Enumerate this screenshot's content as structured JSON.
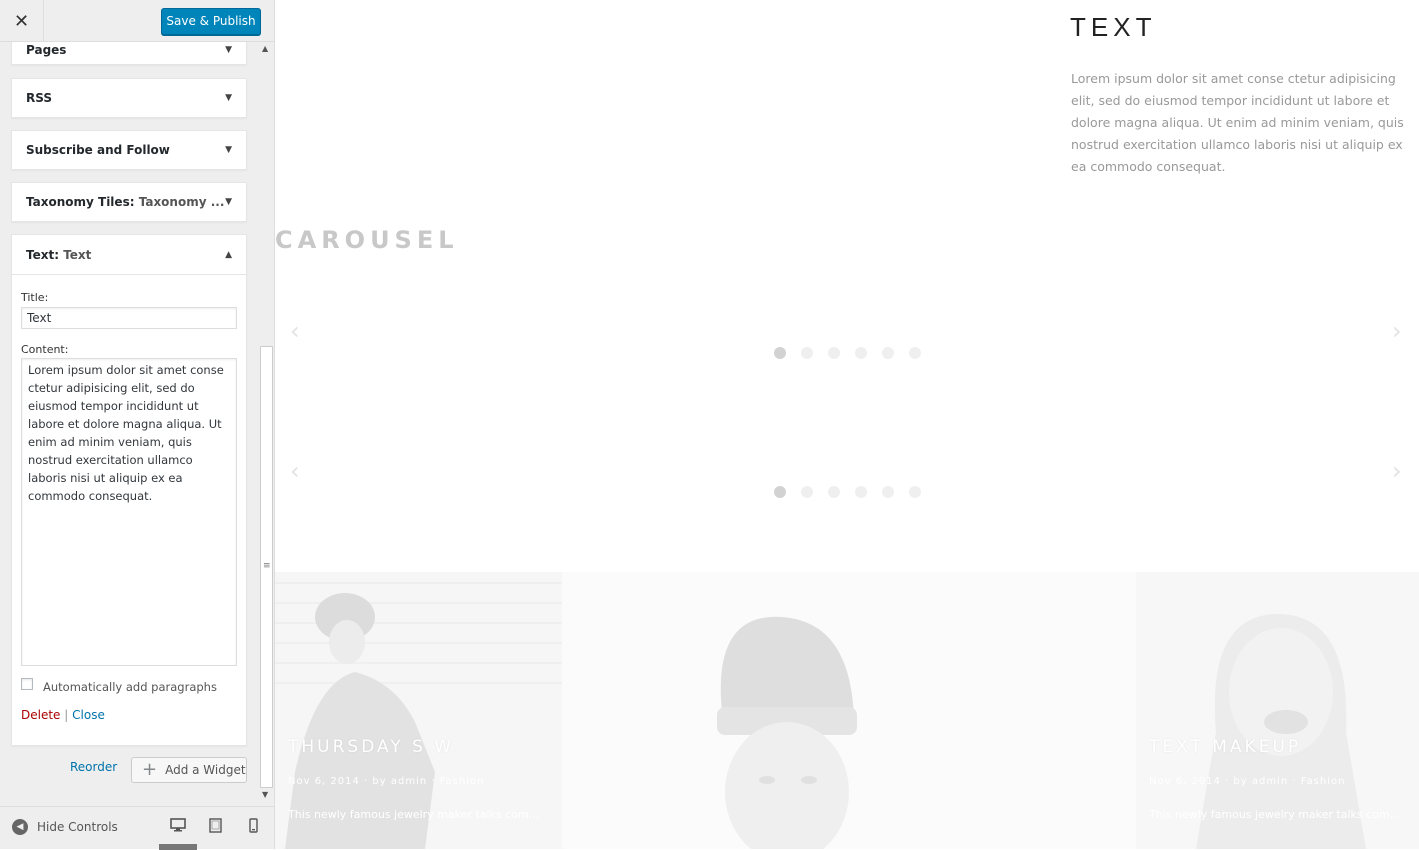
{
  "header": {
    "publish_label": "Save & Publish"
  },
  "widgets": [
    {
      "name": "Pages",
      "subtitle": ""
    },
    {
      "name": "RSS",
      "subtitle": ""
    },
    {
      "name": "Subscribe and Follow",
      "subtitle": ""
    },
    {
      "name": "Taxonomy Tiles:",
      "subtitle": "Taxonomy ..."
    },
    {
      "name": "Text:",
      "subtitle": "Text"
    }
  ],
  "text_widget": {
    "title_label": "Title:",
    "title_value": "Text",
    "content_label": "Content:",
    "content_value": "Lorem ipsum dolor sit amet conse ctetur adipisicing elit, sed do eiusmod tempor incididunt ut labore et dolore magna aliqua. Ut enim ad minim veniam, quis nostrud exercitation ullamco laboris nisi ut aliquip ex ea commodo consequat.",
    "auto_paragraphs_label": "Automatically add paragraphs",
    "delete_label": "Delete",
    "separator": "|",
    "close_label": "Close"
  },
  "panel_actions": {
    "reorder_label": "Reorder",
    "add_widget_label": "Add a Widget"
  },
  "footer": {
    "hide_controls_label": "Hide Controls"
  },
  "preview": {
    "text_title": "TEXT",
    "text_body": "Lorem ipsum dolor sit amet conse ctetur adipisicing elit, sed do eiusmod tempor incididunt ut labore et dolore magna aliqua. Ut enim ad minim veniam, quis nostrud exercitation ullamco laboris nisi ut aliquip ex ea commodo consequat.",
    "carousel_title": "CAROUSEL",
    "carousel_dots": 6,
    "tiles": [
      {
        "caption": "THURSDAY S W",
        "meta": "Nov 6, 2014 · by admin · Fashion",
        "excerpt": "This newly famous jewelry maker talks com..."
      },
      {
        "caption": "",
        "meta": "",
        "excerpt": ""
      },
      {
        "caption": "TEXT MAKEUP",
        "meta": "Nov 6, 2014 · by admin · Fashion",
        "excerpt": "This newly famous jewelry maker talks com..."
      }
    ]
  },
  "colors": {
    "primary_button": "#0085ba",
    "link": "#0073aa",
    "delete_link": "#aa0000",
    "sidebar_bg": "#eeeeee"
  },
  "icons": {
    "close": "close-icon",
    "collapse_arrow": "triangle-down-icon",
    "expand_arrow": "triangle-up-icon",
    "add": "plus-icon",
    "hide_controls": "arrow-left-circle-icon",
    "devices": [
      "desktop-icon",
      "tablet-icon",
      "mobile-icon"
    ]
  }
}
